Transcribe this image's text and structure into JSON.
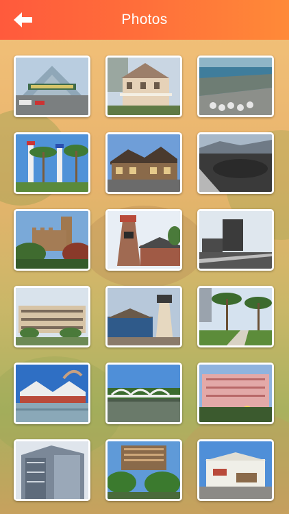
{
  "header": {
    "title": "Photos",
    "back_icon": "arrow-left-icon"
  },
  "colors": {
    "header_start": "#ff5a3c",
    "header_end": "#ff8a38",
    "thumb_border": "#ffffff"
  },
  "photos": [
    {
      "name": "photo-glass-pyramid"
    },
    {
      "name": "photo-victorian-house"
    },
    {
      "name": "photo-port-aerial"
    },
    {
      "name": "photo-palm-towers"
    },
    {
      "name": "photo-lodge-building"
    },
    {
      "name": "photo-crater-landscape"
    },
    {
      "name": "photo-castle-tower"
    },
    {
      "name": "photo-lighthouse-restaurant"
    },
    {
      "name": "photo-office-tower-street"
    },
    {
      "name": "photo-office-building"
    },
    {
      "name": "photo-lighthouse-harbor"
    },
    {
      "name": "photo-palm-path"
    },
    {
      "name": "photo-sail-canopy"
    },
    {
      "name": "photo-white-bridge"
    },
    {
      "name": "photo-pink-hotel"
    },
    {
      "name": "photo-modern-highrise"
    },
    {
      "name": "photo-casino-hotel"
    },
    {
      "name": "photo-beach-shop"
    }
  ]
}
